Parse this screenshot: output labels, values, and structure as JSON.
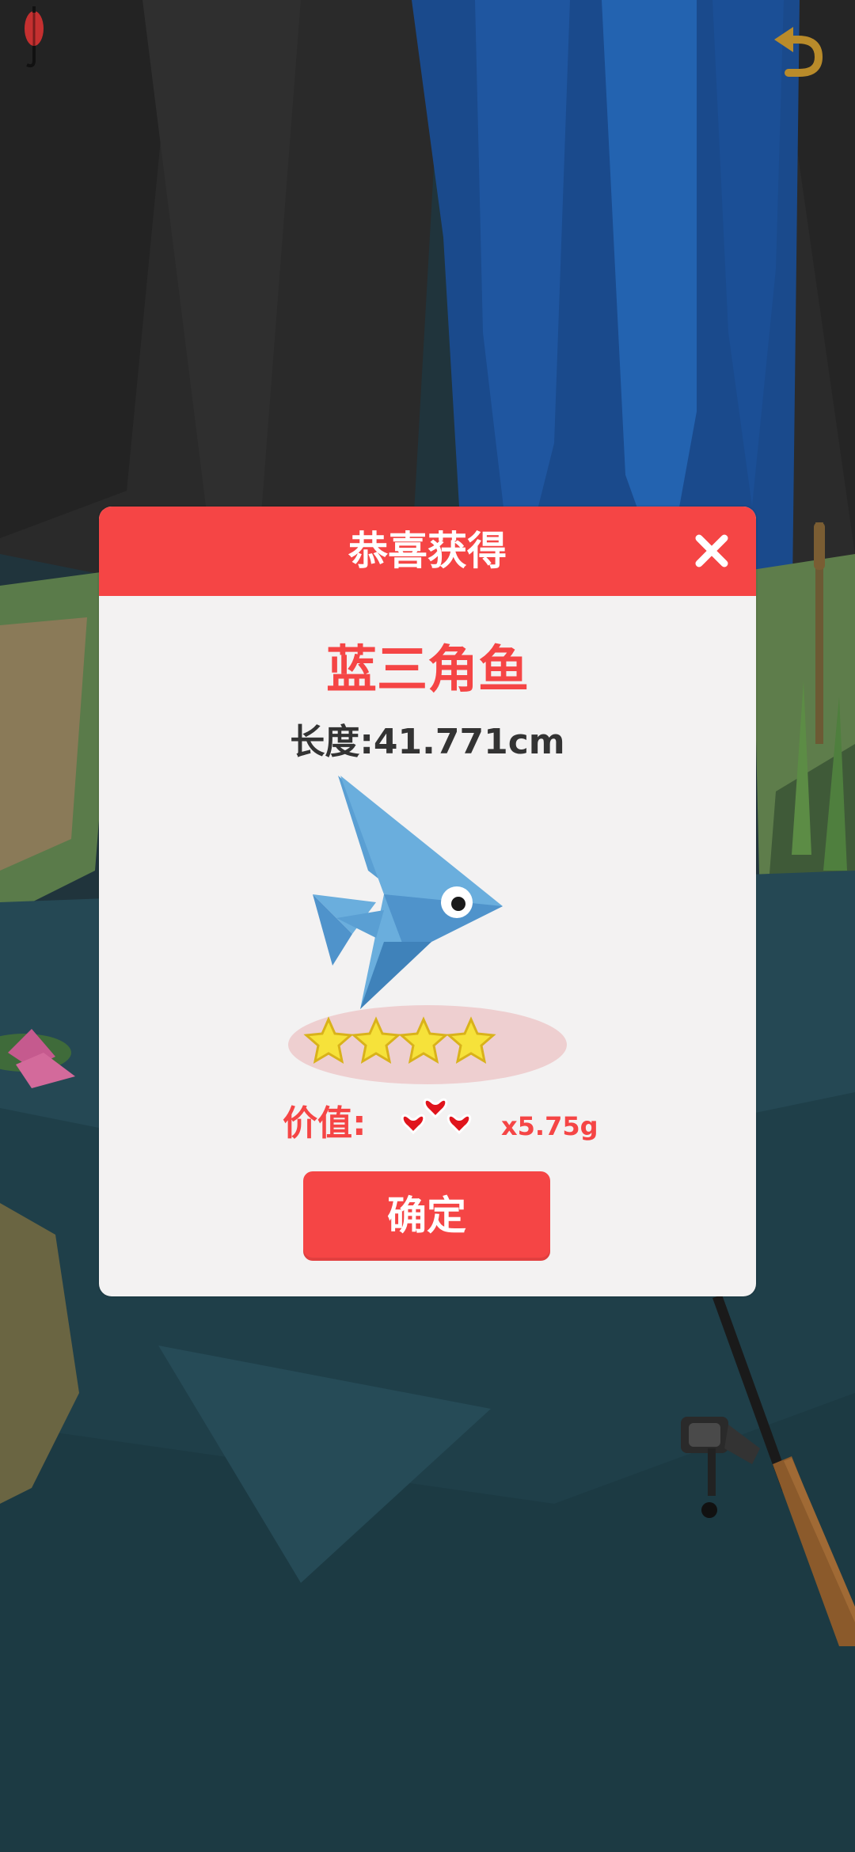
{
  "dialog": {
    "title": "恭喜获得",
    "fish_name": "蓝三角鱼",
    "length_text": "长度:41.771cm",
    "rating_stars": 4,
    "value_label": "价值:",
    "value_amount": "x5.75g",
    "confirm_label": "确定"
  },
  "icons": {
    "close": "close-icon",
    "back": "undo-arrow-icon",
    "lure": "fishing-lure-icon",
    "hearts": "hearts-icon",
    "star": "star-icon"
  },
  "colors": {
    "accent_red": "#f54545",
    "dialog_bg": "#f3f2f2",
    "fish_blue": "#6aaedd",
    "star_yellow": "#f6e23a",
    "water": "#254854"
  }
}
